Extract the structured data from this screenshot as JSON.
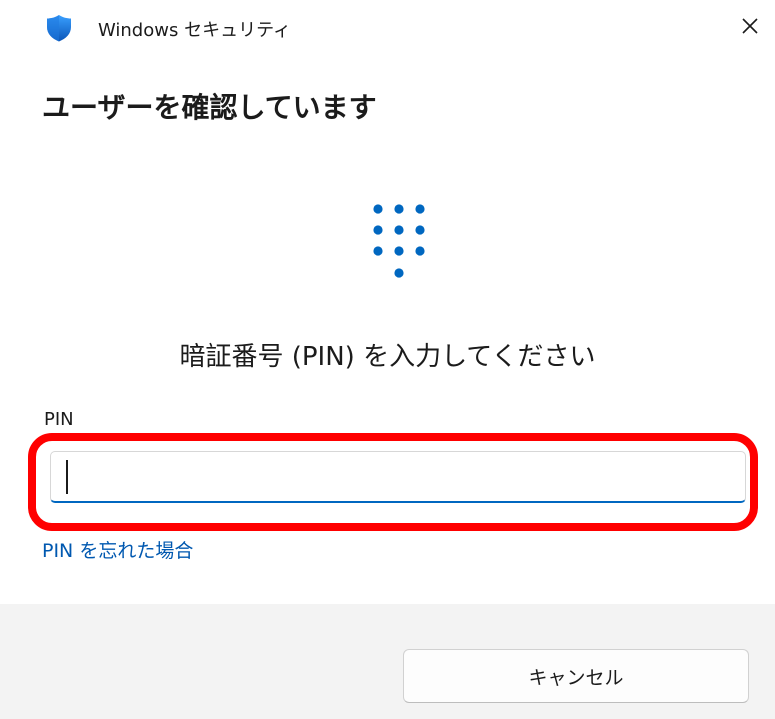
{
  "window": {
    "title": "Windows セキュリティ",
    "close_icon": "close-icon",
    "app_icon": "shield-icon"
  },
  "heading": "ユーザーを確認しています",
  "keypad_icon": "keypad-icon",
  "prompt": "暗証番号 (PIN) を入力してください",
  "pin": {
    "label": "PIN",
    "value": "",
    "placeholder": ""
  },
  "forgot_link": "PIN を忘れた場合",
  "buttons": {
    "cancel": "キャンセル"
  },
  "colors": {
    "accent": "#0067c0",
    "highlight": "#ff0000",
    "link": "#0058b0",
    "footer_bg": "#f3f3f3"
  }
}
